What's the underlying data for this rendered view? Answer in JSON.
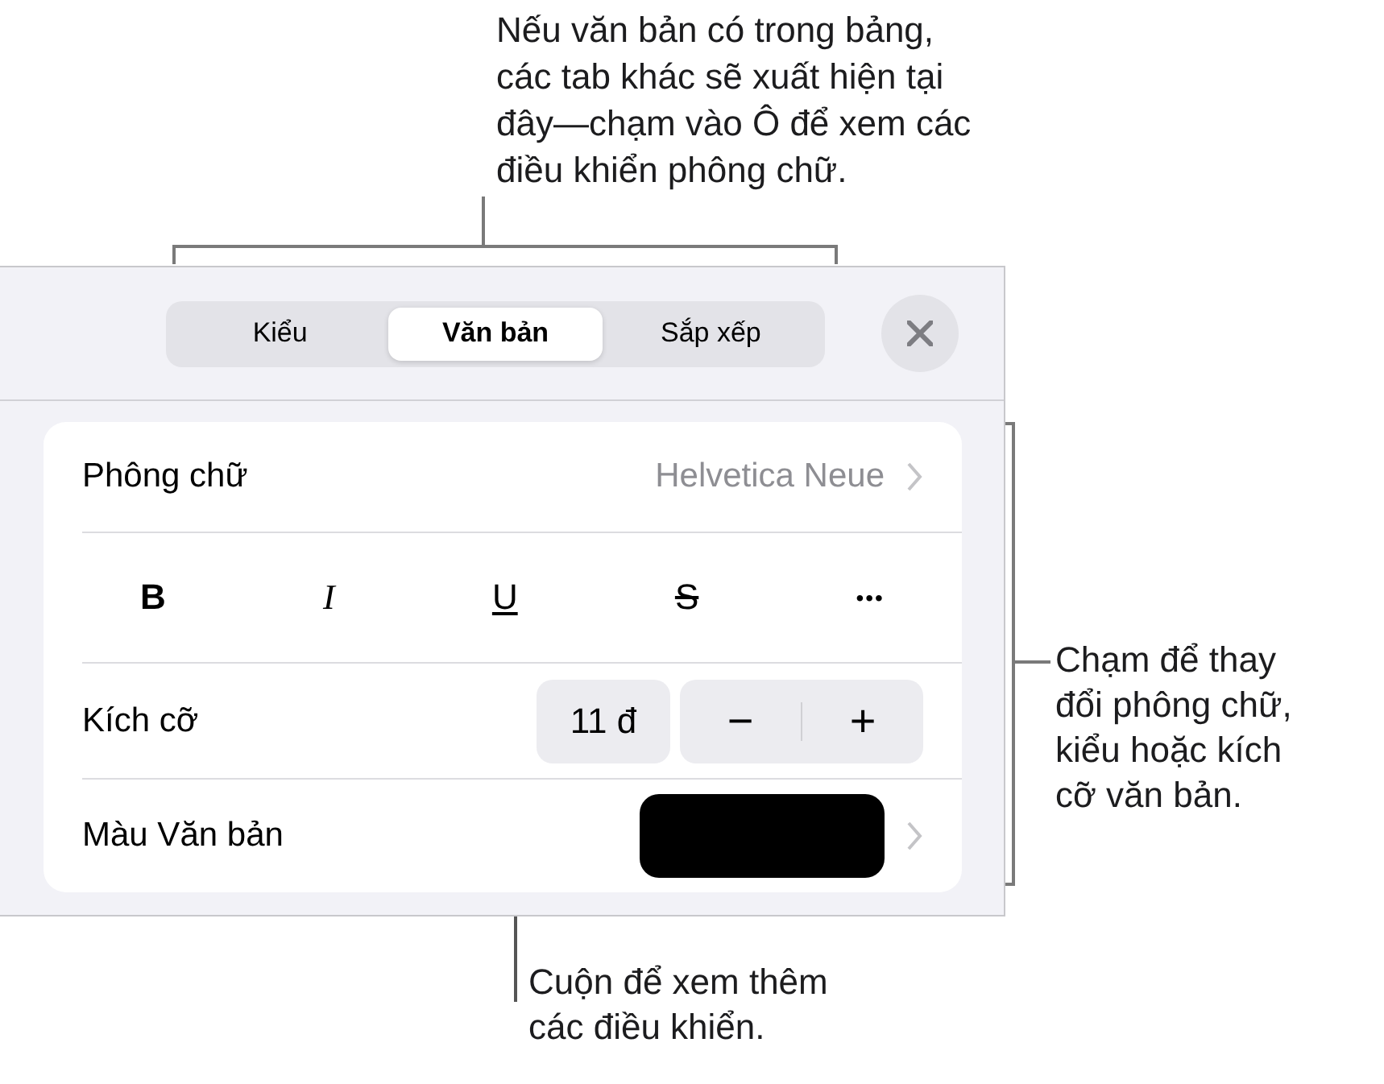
{
  "callouts": [
    {
      "kind": "top",
      "lines": [
        "Nếu văn bản có trong bảng,",
        "các tab khác sẽ xuất hiện tại",
        "đây—chạm vào Ô để xem các",
        "điều khiển phông chữ."
      ]
    },
    {
      "kind": "right",
      "lines": [
        "Chạm để thay",
        "đổi phông chữ,",
        "kiểu hoặc kích",
        "cỡ văn bản."
      ]
    },
    {
      "kind": "bottom",
      "lines": [
        "Cuộn để xem thêm",
        "các điều khiển."
      ]
    }
  ],
  "panel": {
    "tabs": [
      {
        "label": "Kiểu",
        "selected": false
      },
      {
        "label": "Văn bản",
        "selected": true
      },
      {
        "label": "Sắp xếp",
        "selected": false
      }
    ],
    "rows": [
      {
        "kind": "nav",
        "label": "Phông chữ",
        "value": "Helvetica Neue"
      },
      {
        "kind": "styles",
        "buttons": [
          {
            "kind": "bold",
            "label": "B"
          },
          {
            "kind": "italic",
            "label": "I"
          },
          {
            "kind": "underline",
            "label": "U"
          },
          {
            "kind": "strike",
            "label": "S"
          },
          {
            "kind": "more",
            "label": "•••"
          }
        ]
      },
      {
        "kind": "size",
        "label": "Kích cỡ",
        "value": "11 đ",
        "minus": "−",
        "plus": "+"
      },
      {
        "kind": "color",
        "label": "Màu Văn bản",
        "color": "#000000"
      }
    ]
  }
}
